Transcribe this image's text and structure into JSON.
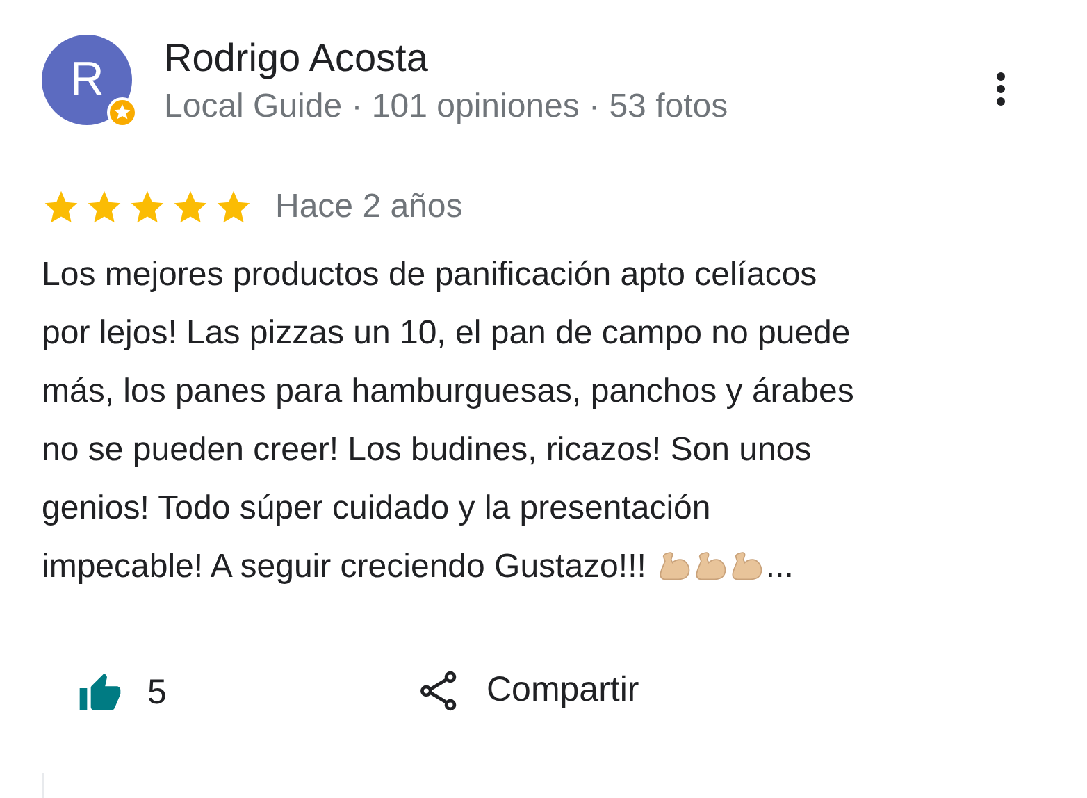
{
  "reviewer": {
    "avatar_letter": "R",
    "name": "Rodrigo Acosta",
    "subtitle": "Local Guide · 101 opiniones · 53 fotos"
  },
  "review": {
    "stars": 5,
    "time": "Hace 2 años",
    "lines": [
      "Los mejores productos de panificación apto celíacos",
      "por lejos! Las pizzas un 10, el pan de campo no puede",
      "más, los panes para hamburguesas, panchos y árabes",
      "no se pueden creer! Los budines, ricazos! Son unos",
      "genios! Todo súper cuidado y la presentación",
      "impecable! A seguir creciendo Gustazo!!!"
    ],
    "ellipsis": "..."
  },
  "actions": {
    "likes": "5",
    "share": "Compartir"
  }
}
